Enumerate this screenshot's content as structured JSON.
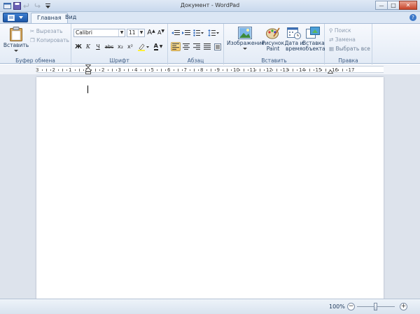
{
  "window": {
    "title": "Документ - WordPad",
    "minimize_glyph": "—",
    "maximize_glyph": "□",
    "close_glyph": "✕"
  },
  "colors": {
    "accent": "#1d57a8",
    "selected": "#f7c967",
    "ribbon": "#e3ebf6",
    "doc_bg": "#dde3ec"
  },
  "tabs": [
    {
      "label": "Главная",
      "active": true
    },
    {
      "label": "Вид",
      "active": false
    }
  ],
  "ribbon": {
    "clipboard": {
      "label": "Буфер обмена",
      "paste": "Вставить",
      "cut": "Вырезать",
      "copy": "Копировать"
    },
    "font": {
      "label": "Шрифт",
      "family": "Calibri",
      "size": "11",
      "grow": "A",
      "shrink": "A",
      "bold": "Ж",
      "italic": "К",
      "underline": "Ч",
      "strike": "abc",
      "subscript": "x₂",
      "superscript": "x²",
      "text_color": "A"
    },
    "paragraph": {
      "label": "Абзац"
    },
    "insert": {
      "label": "Вставить",
      "picture": "Изображение",
      "paint_line1": "Рисунок",
      "paint_line2": "Paint",
      "datetime_line1": "Дата и",
      "datetime_line2": "время",
      "object_line1": "Вставка",
      "object_line2": "объекта"
    },
    "editing": {
      "label": "Правка",
      "find": "Поиск",
      "replace": "Замена",
      "select_all": "Выбрать все"
    }
  },
  "ruler": {
    "numbers": [
      "3",
      "2",
      "1",
      "1",
      "2",
      "3",
      "4",
      "5",
      "6",
      "7",
      "8",
      "9",
      "10",
      "11",
      "12",
      "13",
      "14",
      "15",
      "16",
      "17"
    ]
  },
  "statusbar": {
    "zoom": "100%",
    "zoom_level": 1.0,
    "minus": "−",
    "plus": "+"
  }
}
